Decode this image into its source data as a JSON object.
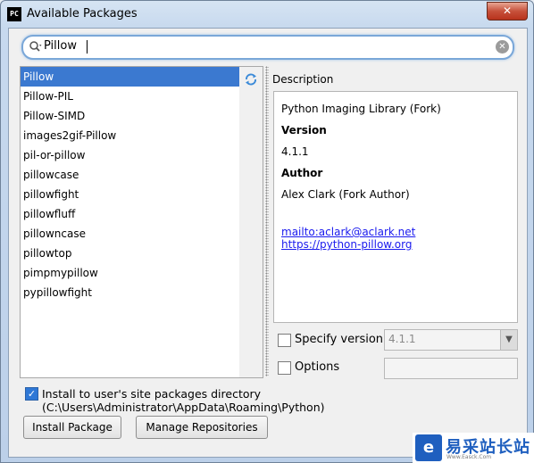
{
  "window": {
    "title": "Available Packages",
    "app_icon_text": "PC",
    "close_label": "✕"
  },
  "search": {
    "value": "Pillow"
  },
  "packages": [
    "Pillow",
    "Pillow-PIL",
    "Pillow-SIMD",
    "images2gif-Pillow",
    "pil-or-pillow",
    "pillowcase",
    "pillowfight",
    "pillowfluff",
    "pillowncase",
    "pillowtop",
    "pimpmypillow",
    "pypillowfight"
  ],
  "selected_package": "Pillow",
  "description": {
    "label": "Description",
    "summary": "Python Imaging Library (Fork)",
    "version_heading": "Version",
    "version_value": "4.1.1",
    "author_heading": "Author",
    "author_value": "Alex Clark (Fork Author)",
    "email_link": "mailto:aclark@aclark.net",
    "homepage_link": "https://python-pillow.org"
  },
  "specify_version": {
    "label": "Specify version",
    "checked": false,
    "selected_value": "4.1.1"
  },
  "options": {
    "label": "Options",
    "checked": false,
    "value": ""
  },
  "install_to_user": {
    "label": "Install to user's site packages directory (C:\\Users\\Administrator\\AppData\\Roaming\\Python)",
    "checked": true
  },
  "buttons": {
    "install": "Install Package",
    "manage": "Manage Repositories"
  },
  "watermark": {
    "logo_text": "e",
    "text": "易采站长站",
    "sub": "Www.Easck.Com"
  },
  "colors": {
    "selection": "#3b79d0",
    "link": "#1a1aee",
    "checkbox_checked": "#2f78d6"
  }
}
